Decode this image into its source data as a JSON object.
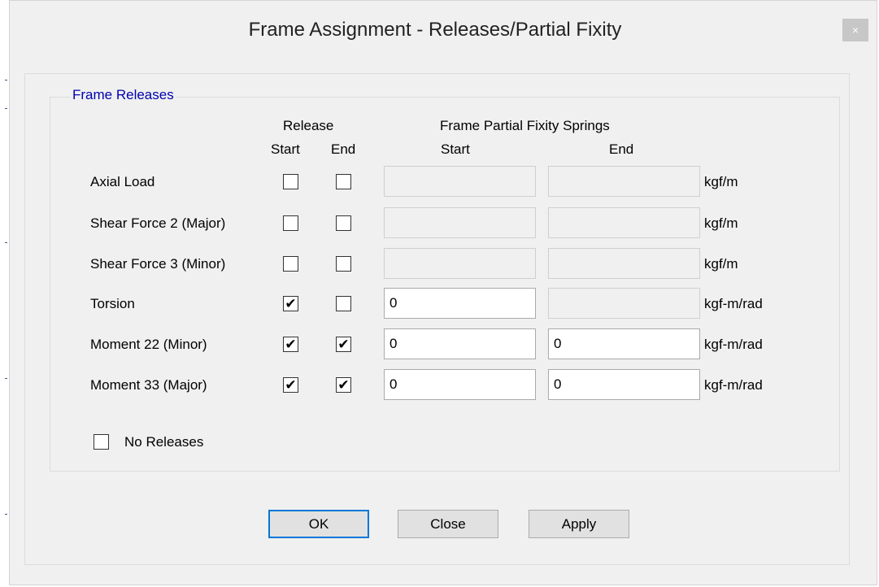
{
  "window": {
    "title": "Frame Assignment - Releases/Partial Fixity",
    "close_glyph": "×"
  },
  "group": {
    "legend": "Frame Releases"
  },
  "headers": {
    "release": "Release",
    "release_start": "Start",
    "release_end": "End",
    "springs": "Frame Partial Fixity Springs",
    "springs_start": "Start",
    "springs_end": "End"
  },
  "rows": [
    {
      "label": "Axial Load",
      "start_checked": false,
      "end_checked": false,
      "start_value": "",
      "end_value": "",
      "start_enabled": false,
      "end_enabled": false,
      "unit": "kgf/m"
    },
    {
      "label": "Shear Force 2 (Major)",
      "start_checked": false,
      "end_checked": false,
      "start_value": "",
      "end_value": "",
      "start_enabled": false,
      "end_enabled": false,
      "unit": "kgf/m"
    },
    {
      "label": "Shear Force 3 (Minor)",
      "start_checked": false,
      "end_checked": false,
      "start_value": "",
      "end_value": "",
      "start_enabled": false,
      "end_enabled": false,
      "unit": "kgf/m"
    },
    {
      "label": "Torsion",
      "start_checked": true,
      "end_checked": false,
      "start_value": "0",
      "end_value": "",
      "start_enabled": true,
      "end_enabled": false,
      "unit": "kgf-m/rad"
    },
    {
      "label": "Moment 22 (Minor)",
      "start_checked": true,
      "end_checked": true,
      "start_value": "0",
      "end_value": "0",
      "start_enabled": true,
      "end_enabled": true,
      "unit": "kgf-m/rad"
    },
    {
      "label": "Moment 33 (Major)",
      "start_checked": true,
      "end_checked": true,
      "start_value": "0",
      "end_value": "0",
      "start_enabled": true,
      "end_enabled": true,
      "unit": "kgf-m/rad"
    }
  ],
  "no_releases": {
    "label": "No Releases",
    "checked": false
  },
  "buttons": {
    "ok": "OK",
    "close": "Close",
    "apply": "Apply"
  },
  "check_glyph": "✔"
}
